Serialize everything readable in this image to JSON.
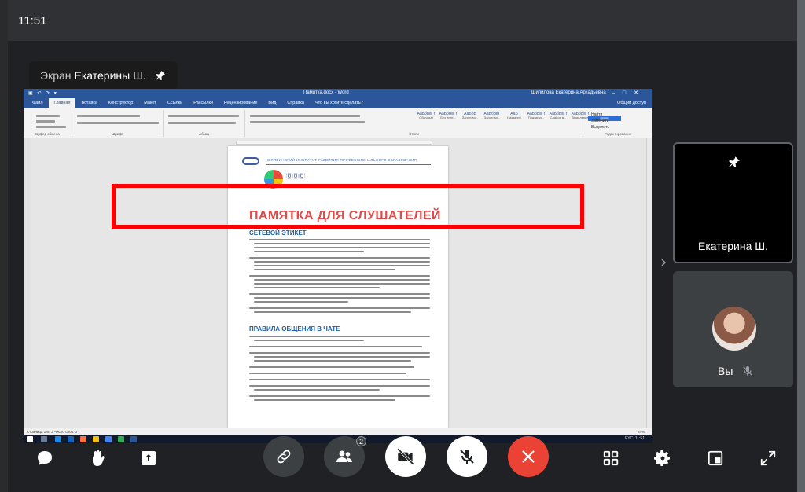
{
  "clock": "11:51",
  "screen_share": {
    "label": "Экран",
    "owner": "Екатерины Ш."
  },
  "word": {
    "doc_title": "Памятка.docx - Word",
    "user": "Шипилова Екатерина Аркадьевна",
    "tabs": [
      "Файл",
      "Главная",
      "Вставка",
      "Конструктор",
      "Макет",
      "Ссылки",
      "Рассылки",
      "Рецензирование",
      "Вид",
      "Справка",
      "Что вы хотите сделать?"
    ],
    "share": "Общий доступ",
    "ribbon_groups": [
      "Буфер обмена",
      "Шрифт",
      "Абзац",
      "Стили",
      "Редактирование"
    ],
    "styles": [
      {
        "sample": "АаБбВвГг",
        "name": "Обычный"
      },
      {
        "sample": "АаБбВвГг",
        "name": "Без инте..."
      },
      {
        "sample": "АаБбВ",
        "name": "Заголово..."
      },
      {
        "sample": "АаБбВвГ",
        "name": "Заголово..."
      },
      {
        "sample": "АаБ",
        "name": "Название"
      },
      {
        "sample": "АаБбВвГг",
        "name": "Подзагол..."
      },
      {
        "sample": "АаБбВвГг",
        "name": "Слабое в..."
      },
      {
        "sample": "АаБбВвГг",
        "name": "Выделение"
      }
    ],
    "find": "Найти",
    "replace": "Заменить",
    "select": "Выделить",
    "status_left": "Страница 1 из 2   Число слов: 0",
    "status_right": "84%",
    "tray_time": "11:51",
    "tray_lang": "РУС"
  },
  "document": {
    "header": "ЧЕЛЯБИНСКИЙ ИНСТИТУТ РАЗВИТИЯ ПРОФЕССИОНАЛЬНОГО ОБРАЗОВАНИЯ",
    "title": "ПАМЯТКА ДЛЯ СЛУШАТЕЛЕЙ",
    "section1": "СЕТЕВОЙ ЭТИКЕТ",
    "section2": "ПРАВИЛА ОБЩЕНИЯ В ЧАТЕ"
  },
  "participants": [
    {
      "name": "Екатерина Ш.",
      "pinned": true
    },
    {
      "name": "Вы",
      "muted": true
    }
  ],
  "controls": {
    "participants_count": "2"
  }
}
